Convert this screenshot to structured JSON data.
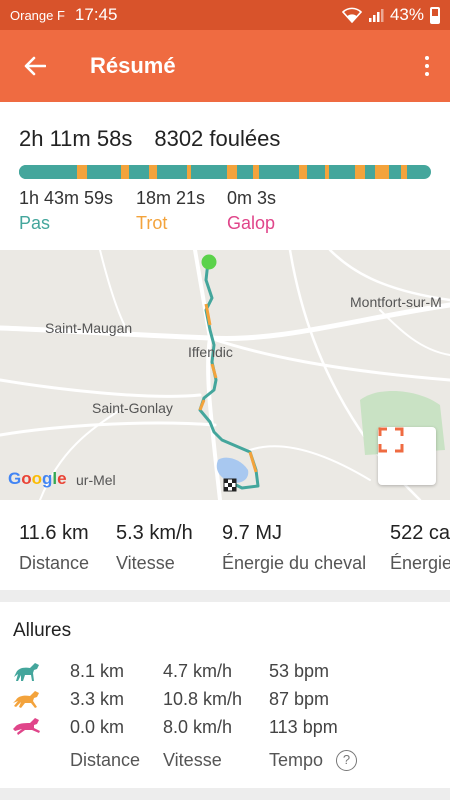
{
  "status": {
    "carrier": "Orange F",
    "time": "17:45",
    "battery": "43%"
  },
  "appbar": {
    "title": "Résumé",
    "back_icon": "arrow-back-icon",
    "menu_icon": "more-vert-icon"
  },
  "summary": {
    "duration": "2h 11m 58s",
    "strides": "8302 foulées",
    "gaits": [
      {
        "time": "1h 43m 59s",
        "label": "Pas",
        "color": "#44a69c"
      },
      {
        "time": "18m 21s",
        "label": "Trot",
        "color": "#f3a33c"
      },
      {
        "time": "0m 3s",
        "label": "Galop",
        "color": "#e0458a"
      }
    ]
  },
  "map": {
    "places": [
      "Montfort-sur-M",
      "Saint-Maugan",
      "Iffendic",
      "Saint-Gonlay",
      "ur-Mel"
    ],
    "attribution": "Google",
    "expand_icon": "fullscreen-icon"
  },
  "stats": [
    {
      "value": "11.6 km",
      "label": "Distance"
    },
    {
      "value": "5.3 km/h",
      "label": "Vitesse"
    },
    {
      "value": "9.7 MJ",
      "label": "Énergie du cheval"
    },
    {
      "value": "522 ca",
      "label": "Énergie"
    }
  ],
  "allures": {
    "title": "Allures",
    "rows": [
      {
        "icon": "walking-horse-icon",
        "color": "#44a69c",
        "distance": "8.1 km",
        "speed": "4.7 km/h",
        "tempo": "53 bpm"
      },
      {
        "icon": "trotting-horse-icon",
        "color": "#f3a33c",
        "distance": "3.3 km",
        "speed": "10.8 km/h",
        "tempo": "87 bpm"
      },
      {
        "icon": "galloping-horse-icon",
        "color": "#e0458a",
        "distance": "0.0 km",
        "speed": "8.0 km/h",
        "tempo": "113 bpm"
      }
    ],
    "headers": {
      "distance": "Distance",
      "speed": "Vitesse",
      "tempo": "Tempo"
    },
    "help": "?"
  }
}
